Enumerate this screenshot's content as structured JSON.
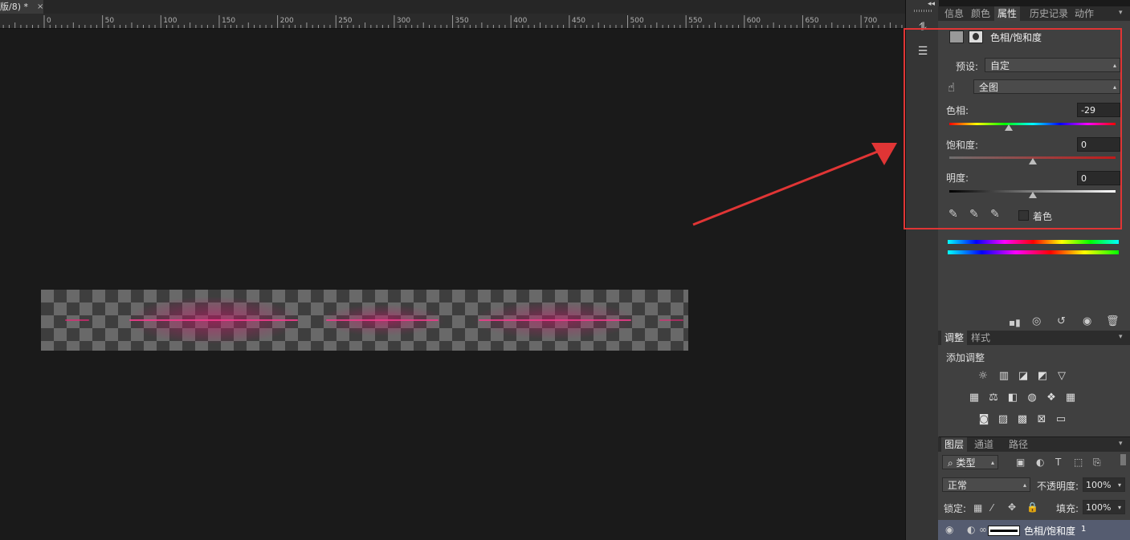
{
  "document": {
    "tab_title": "版/8) *",
    "close_glyph": "×"
  },
  "ruler": {
    "labels": [
      "0",
      "50",
      "100",
      "150",
      "200",
      "250",
      "300",
      "350",
      "400",
      "450",
      "500",
      "550",
      "600",
      "650",
      "700"
    ]
  },
  "colors": {
    "highlight_box": "#e03535",
    "arrow": "#e03535",
    "glow": "#d0136a"
  },
  "toolbar": {
    "icons": [
      "adjustment-tool-icon",
      "properties-toggle-icon"
    ]
  },
  "properties_panel": {
    "tabs": [
      "信息",
      "颜色",
      "属性",
      "历史记录",
      "动作"
    ],
    "active_tab": "属性",
    "title": "色相/饱和度",
    "preset_label": "预设:",
    "preset_value": "自定",
    "range_value": "全图",
    "hue_label": "色相:",
    "hue_value": "-29",
    "saturation_label": "饱和度:",
    "saturation_value": "0",
    "lightness_label": "明度:",
    "lightness_value": "0",
    "colorize_label": "着色",
    "colorize_checked": false,
    "slider_levels": {
      "hue": -29,
      "saturation": 0,
      "lightness": 0
    }
  },
  "adjustments_panel": {
    "tabs": [
      "调整",
      "样式"
    ],
    "active_tab": "调整",
    "heading": "添加调整"
  },
  "layers_panel": {
    "tabs": [
      "图层",
      "通道",
      "路径"
    ],
    "active_tab": "图层",
    "filter_label": "类型",
    "blend_mode": "正常",
    "opacity_label": "不透明度:",
    "opacity_value": "100%",
    "lock_label": "锁定:",
    "fill_label": "填充:",
    "fill_value": "100%",
    "layer_name": "色相/饱和度",
    "layer_suffix": "1"
  }
}
